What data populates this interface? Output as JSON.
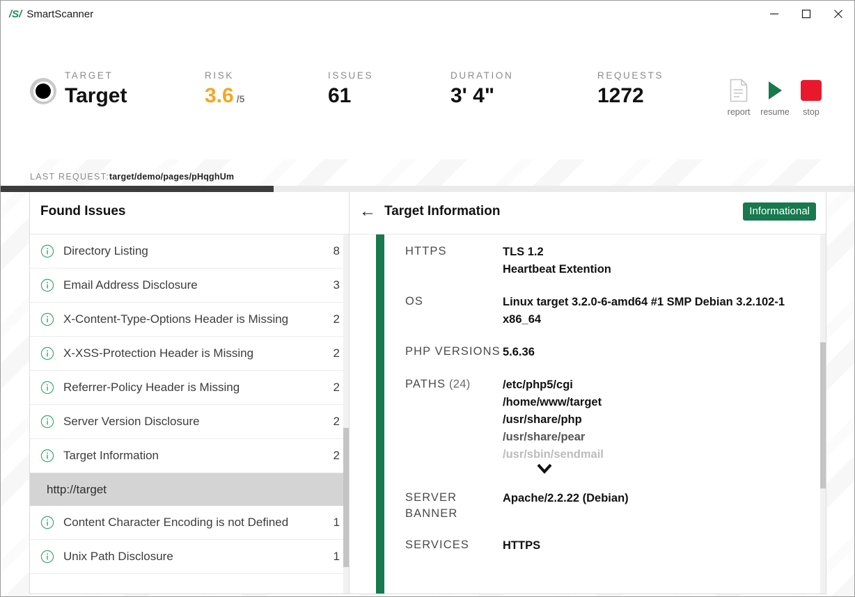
{
  "window": {
    "brand_mark": "/S/",
    "title": "SmartScanner",
    "controls": {
      "minimize": "minimize-button",
      "maximize": "maximize-button",
      "close": "close-button"
    }
  },
  "header": {
    "stats": [
      {
        "label": "TARGET",
        "value": "Target"
      },
      {
        "label": "RISK",
        "value": "3.6",
        "denominator": "/5"
      },
      {
        "label": "ISSUES",
        "value": "61"
      },
      {
        "label": "DURATION",
        "value": "3' 4\""
      },
      {
        "label": "REQUESTS",
        "value": "1272"
      }
    ],
    "actions": [
      {
        "label": "report",
        "icon": "document-icon"
      },
      {
        "label": "resume",
        "icon": "play-icon"
      },
      {
        "label": "stop",
        "icon": "stop-icon"
      }
    ],
    "last_request": {
      "label": "LAST REQUEST:",
      "value": "target/demo/pages/pHqghUm"
    },
    "progress_percent": 32
  },
  "issues_panel": {
    "title": "Found Issues",
    "rows": [
      {
        "type": "issue",
        "icon": "info-icon",
        "name": "Directory Listing",
        "count": "8"
      },
      {
        "type": "issue",
        "icon": "info-icon",
        "name": "Email Address Disclosure",
        "count": "3"
      },
      {
        "type": "issue",
        "icon": "info-icon",
        "name": "X-Content-Type-Options Header is Missing",
        "count": "2"
      },
      {
        "type": "issue",
        "icon": "info-icon",
        "name": "X-XSS-Protection Header is Missing",
        "count": "2"
      },
      {
        "type": "issue",
        "icon": "info-icon",
        "name": "Referrer-Policy Header is Missing",
        "count": "2"
      },
      {
        "type": "issue",
        "icon": "info-icon",
        "name": "Server Version Disclosure",
        "count": "2"
      },
      {
        "type": "issue",
        "icon": "info-icon",
        "name": "Target Information",
        "count": "2"
      },
      {
        "type": "group",
        "name": "http://target"
      },
      {
        "type": "issue",
        "icon": "info-icon",
        "name": "Content Character Encoding is not Defined",
        "count": "1"
      },
      {
        "type": "issue",
        "icon": "info-icon",
        "name": "Unix Path Disclosure",
        "count": "1"
      }
    ]
  },
  "detail_panel": {
    "back": "back-arrow",
    "title": "Target Information",
    "severity": "Informational",
    "rows": [
      {
        "key": "HTTPS",
        "values": [
          "TLS 1.2",
          "Heartbeat Extention"
        ]
      },
      {
        "key": "OS",
        "values": [
          "Linux target 3.2.0-6-amd64 #1 SMP Debian 3.2.102-1 x86_64"
        ]
      },
      {
        "key": "PHP VERSIONS",
        "values": [
          "5.6.36"
        ]
      },
      {
        "key": "PATHS",
        "key_count": "(24)",
        "values": [
          "/etc/php5/cgi",
          "/home/www/target",
          "/usr/share/php",
          "/usr/share/pear",
          "/usr/sbin/sendmail"
        ],
        "expandable": true
      },
      {
        "key": "SERVER BANNER",
        "values": [
          "Apache/2.2.22 (Debian)"
        ]
      },
      {
        "key": "SERVICES",
        "values": [
          "HTTPS"
        ]
      }
    ]
  },
  "colors": {
    "brand_green": "#1f8a5a",
    "accent_green": "#17794d",
    "risk_amber": "#f5a623",
    "stop_red": "#e8192c"
  }
}
